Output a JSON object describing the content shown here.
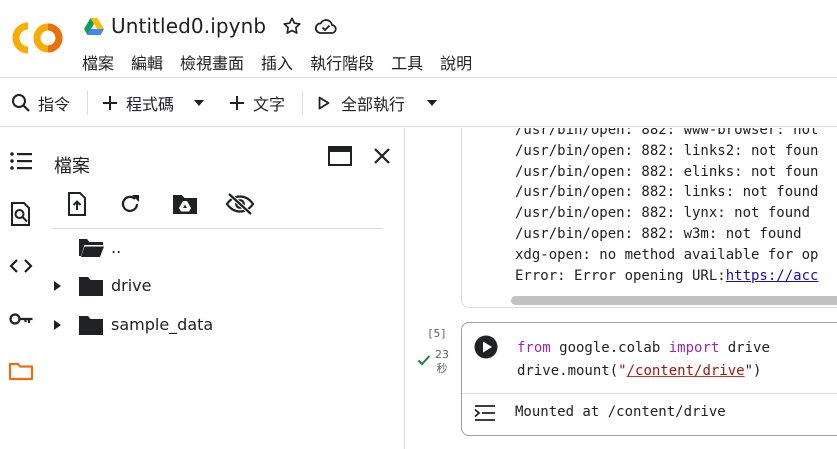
{
  "header": {
    "title": "Untitled0.ipynb",
    "logo": "CO",
    "menu": [
      "檔案",
      "編輯",
      "檢視畫面",
      "插入",
      "執行階段",
      "工具",
      "說明"
    ]
  },
  "toolbar": {
    "commands_label": "指令",
    "code_label": "程式碼",
    "text_label": "文字",
    "run_all_label": "全部執行"
  },
  "sidebar": {
    "rail_icons": [
      "toc-icon",
      "search-icon",
      "code-snippets-icon",
      "key-icon",
      "folder-icon"
    ],
    "active_color": "#e8710a"
  },
  "files": {
    "title": "檔案",
    "items": [
      {
        "name": "..",
        "expandable": false
      },
      {
        "name": "drive",
        "expandable": true
      },
      {
        "name": "sample_data",
        "expandable": true
      }
    ]
  },
  "output": {
    "lines": [
      "/usr/bin/open: 882: www-browser: not",
      "/usr/bin/open: 882: links2: not foun",
      "/usr/bin/open: 882: elinks: not foun",
      "/usr/bin/open: 882: links: not found",
      "/usr/bin/open: 882: lynx: not found",
      "/usr/bin/open: 882: w3m: not found",
      "xdg-open: no method available for op"
    ],
    "error_prefix": "Error: Error opening URL:",
    "error_link": "https://acc"
  },
  "cell": {
    "exec_count": "[5]",
    "exec_time": "23",
    "exec_unit": "秒",
    "code_kw_from": "from",
    "code_module": " google.colab ",
    "code_kw_import": "import",
    "code_name": " drive",
    "code_line2_a": "drive.mount(",
    "code_quote_open": "\"",
    "code_path": "/content/drive",
    "code_quote_close": "\")",
    "result": "Mounted at /content/drive"
  }
}
